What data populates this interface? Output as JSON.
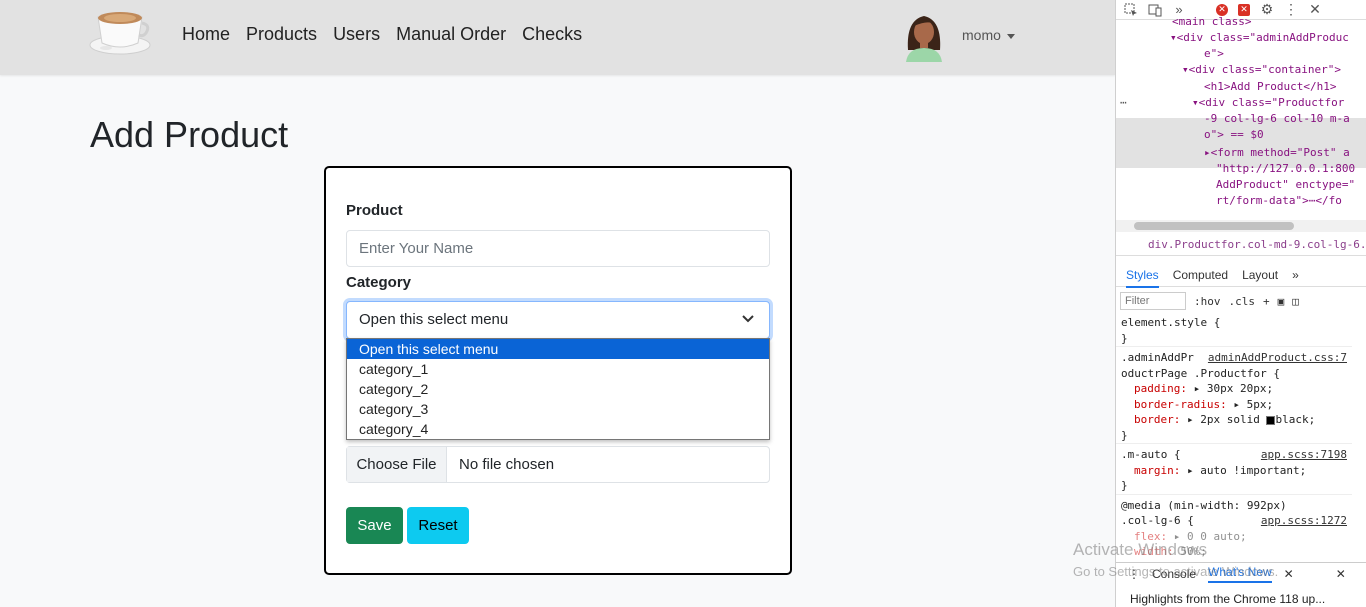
{
  "nav": {
    "links": [
      "Home",
      "Products",
      "Users",
      "Manual Order",
      "Checks"
    ],
    "user_name": "momo"
  },
  "page": {
    "title": "Add Product"
  },
  "form": {
    "product_label": "Product",
    "product_placeholder": "Enter Your Name",
    "category_label": "Category",
    "category_selected": "Open this select menu",
    "category_options": [
      "Open this select menu",
      "category_1",
      "category_2",
      "category_3",
      "category_4"
    ],
    "file_button": "Choose File",
    "file_text": "No file chosen",
    "save_label": "Save",
    "reset_label": "Reset"
  },
  "devtools": {
    "dom": {
      "l0": "<main class>",
      "l1a": "<div class=\"adminAddProduc",
      "l1b": "e\">",
      "l2": "<div class=\"container\">",
      "l3": "<h1>Add Product</h1>",
      "l4a": "<div class=\"Productfor",
      "l4b": "-9 col-lg-6 col-10 m-a",
      "l4c": "o\"> == $0",
      "l5a": "<form method=\"Post\" a",
      "l5b": "\"http://127.0.0.1:800",
      "l5c": "AddProduct\" enctype=\"",
      "l5d": "rt/form-data\">⋯</fo"
    },
    "breadcrumb": "div.Productfor.col-md-9.col-lg-6.col-",
    "tabs": [
      "Styles",
      "Computed",
      "Layout"
    ],
    "filter_placeholder": "Filter",
    "hov": ":hov",
    "cls": ".cls",
    "rules": [
      {
        "selector": "element.style {",
        "source": "",
        "props": [],
        "close": "}"
      },
      {
        "selector": ".adminAddPr",
        "selector2": "oductrPage .Productfor {",
        "source": "adminAddProduct.css:7",
        "props": [
          {
            "name": "padding",
            "value": "30px 20px;"
          },
          {
            "name": "border-radius",
            "value": "5px;"
          },
          {
            "name": "border",
            "value": "2px solid ",
            "value2": "black;"
          }
        ],
        "close": "}"
      },
      {
        "selector": ".m-auto {",
        "source": "app.scss:7198",
        "props": [
          {
            "name": "margin",
            "value": "auto !important;"
          }
        ],
        "close": "}"
      },
      {
        "selector": "@media (min-width: 992px)",
        "selector2": ".col-lg-6 {",
        "source": "app.scss:1272",
        "props": [
          {
            "name": "flex",
            "value": "0 0 auto;"
          },
          {
            "name": "width",
            "value": "50%;"
          }
        ],
        "close": ""
      }
    ],
    "console_tabs": [
      "Console",
      "What's New"
    ],
    "highlights": "Highlights from the Chrome 118 up..."
  },
  "watermark": {
    "line1": "Activate Windows",
    "line2": "Go to Settings to activate Windows."
  }
}
